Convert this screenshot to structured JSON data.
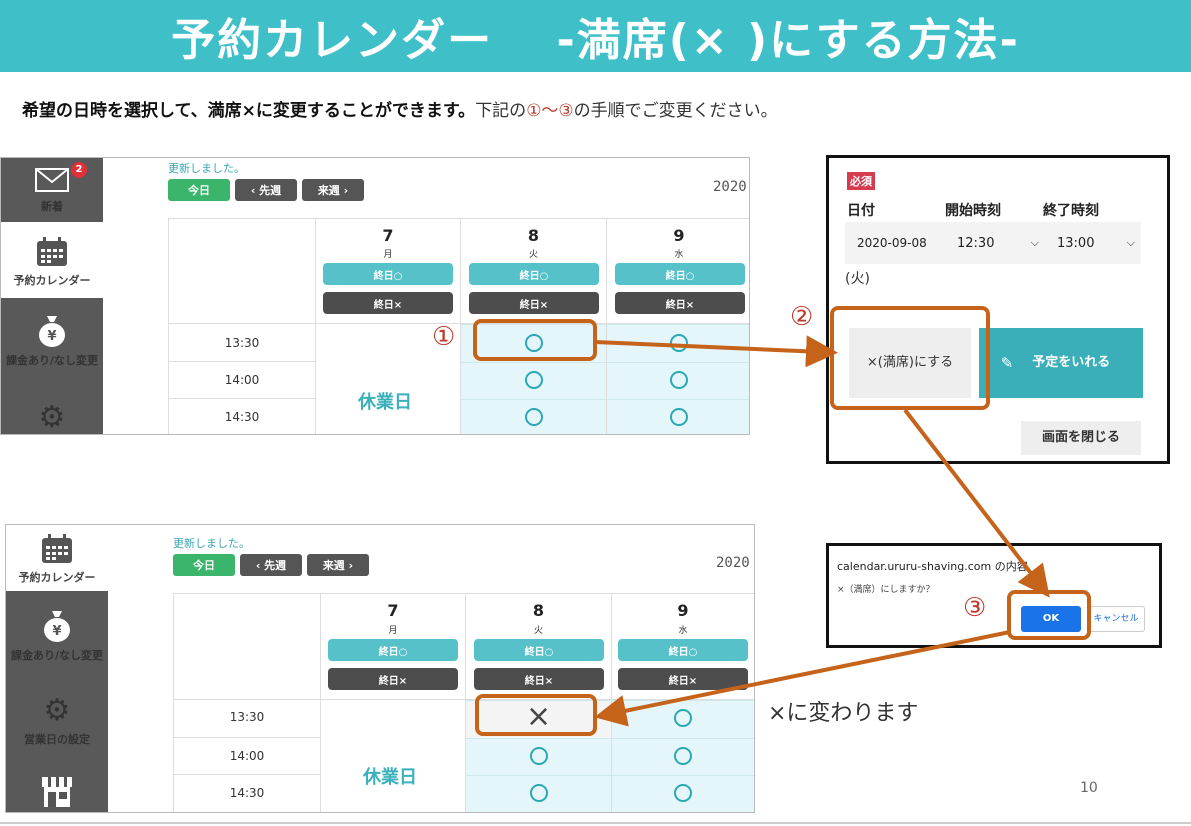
{
  "title": "予約カレンダー　 -満席(× )にする方法-",
  "intro": {
    "bold": "希望の日時を選択して、満席×に変更することができます。",
    "normal_a": "下記の",
    "steps": "①〜③",
    "normal_b": "の手順でご変更ください。"
  },
  "steps": [
    "①",
    "②",
    "③"
  ],
  "sidebar_top": {
    "items": [
      {
        "label": "新着",
        "icon": "envelope-icon",
        "badge": "2"
      },
      {
        "label": "予約カレンダー",
        "icon": "calendar-icon"
      },
      {
        "label": "課金あり/なし変更",
        "icon": "moneybag-icon"
      },
      {
        "label": "",
        "icon": "gear-icon"
      }
    ]
  },
  "sidebar_bottom": {
    "items": [
      {
        "label": "予約カレンダー",
        "icon": "calendar-icon"
      },
      {
        "label": "課金あり/なし変更",
        "icon": "moneybag-icon"
      },
      {
        "label": "営業日の設定",
        "icon": "gear-icon"
      },
      {
        "label": "",
        "icon": "shop-icon"
      }
    ]
  },
  "calendar": {
    "updated": "更新しました。",
    "today": "今日",
    "prev": "‹ 先週",
    "next": "来週 ›",
    "year": "2020",
    "days": [
      {
        "num": "7",
        "wk": "月",
        "allday_open": "終日○",
        "allday_full": "終日×"
      },
      {
        "num": "8",
        "wk": "火",
        "allday_open": "終日○",
        "allday_full": "終日×"
      },
      {
        "num": "9",
        "wk": "水",
        "allday_open": "終日○",
        "allday_full": "終日×"
      }
    ],
    "times": [
      "13:30",
      "14:00",
      "14:30"
    ],
    "closed": "休業日",
    "open_mark": "○",
    "full_mark": "×"
  },
  "dialog": {
    "required": "必須",
    "date_label": "日付",
    "start_label": "開始時刻",
    "end_label": "終了時刻",
    "date_value": "2020-09-08",
    "date_suffix": "(火)",
    "start_value": "12:30",
    "end_value": "13:00",
    "full_button": "×(満席)にする",
    "reserve_button": "予定をいれる",
    "close_button": "画面を閉じる"
  },
  "confirm": {
    "origin": "calendar.ururu-shaving.com の内容",
    "message": "×（満席）にしますか？",
    "ok": "OK",
    "cancel": "キャンセル"
  },
  "result_note": "×に変わります",
  "page_number": "10",
  "colors": {
    "accent": "#3fc0c9",
    "arrow": "#c5631a",
    "step": "#c0392b"
  }
}
